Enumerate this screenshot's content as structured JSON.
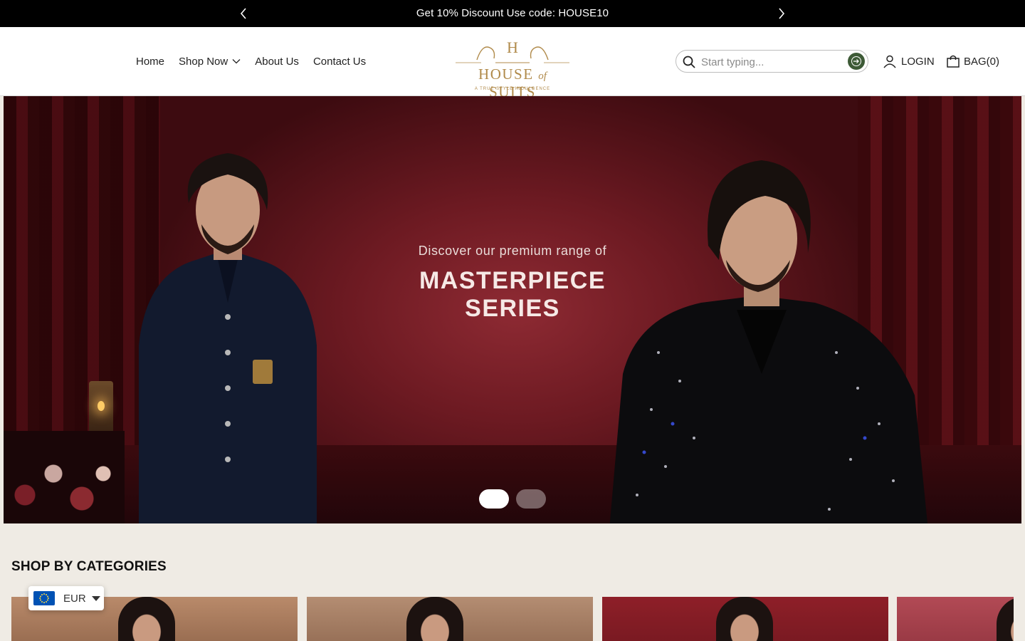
{
  "announcement": {
    "message": "Get 10% Discount Use code: HOUSE10",
    "prev_icon": "chevron-left-icon",
    "next_icon": "chevron-right-icon"
  },
  "nav": {
    "items": [
      {
        "label": "Home"
      },
      {
        "label": "Shop Now",
        "icon": "chevron-down-icon"
      },
      {
        "label": "About Us"
      },
      {
        "label": "Contact Us"
      }
    ]
  },
  "logo": {
    "name_left": "HOUSE",
    "name_mid": "of",
    "name_right": "SUITS",
    "tagline": "A TRUE STYLE INDULGENCE",
    "monogram": "H"
  },
  "search": {
    "placeholder": "Start typing...",
    "icon": "search-icon",
    "submit_icon": "arrow-right-circle-icon"
  },
  "account": {
    "login_label": "LOGIN",
    "bag_label": "BAG(0)"
  },
  "hero": {
    "subtitle": "Discover our premium range of",
    "title_line1": "MASTERPIECE",
    "title_line2": "SERIES",
    "slides": 2,
    "active_slide": 1
  },
  "categories": {
    "title": "SHOP BY CATEGORIES"
  },
  "currency": {
    "code": "EUR",
    "flag": "eu-flag-icon"
  },
  "colors": {
    "announcement_bg": "#000000",
    "accent_gold": "#b08a4a",
    "search_button": "#3d5a36",
    "page_bg": "#efebe4",
    "flag_blue": "#0052b4"
  }
}
